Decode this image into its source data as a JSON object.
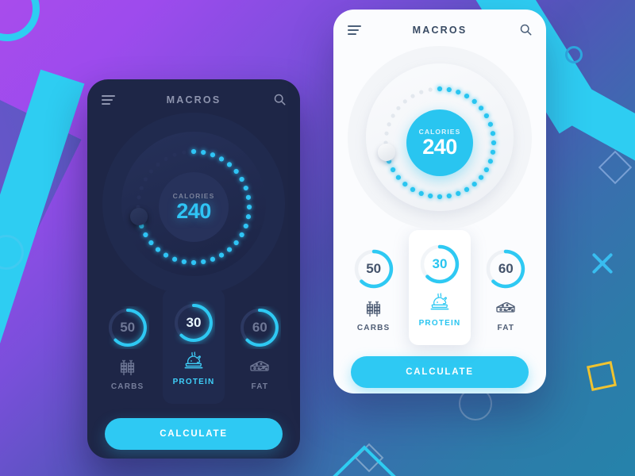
{
  "meta": {
    "accent_cyan": "#29c5f0",
    "dark_bg": "#1e2647",
    "light_bg": "#fbfcfe",
    "gold": "#f0c330"
  },
  "phone_dark": {
    "header": {
      "menu_icon": "hamburger-menu-icon",
      "title": "MACROS",
      "search_icon": "search-icon"
    },
    "dial": {
      "label": "CALORIES",
      "value": "240",
      "progress_pct": 72,
      "total_dots": 36
    },
    "macros": [
      {
        "value": "50",
        "name": "CARBS",
        "icon": "wheat-icon",
        "progress_pct": 72,
        "selected": false
      },
      {
        "value": "30",
        "name": "PROTEIN",
        "icon": "roast-chicken-icon",
        "progress_pct": 72,
        "selected": true
      },
      {
        "value": "60",
        "name": "FAT",
        "icon": "cheese-wedge-icon",
        "progress_pct": 72,
        "selected": false
      }
    ],
    "calculate_label": "CALCULATE"
  },
  "phone_light": {
    "header": {
      "menu_icon": "hamburger-menu-icon",
      "title": "MACROS",
      "search_icon": "search-icon"
    },
    "dial": {
      "label": "CALORIES",
      "value": "240",
      "progress_pct": 72,
      "total_dots": 36
    },
    "macros": [
      {
        "value": "50",
        "name": "CARBS",
        "icon": "wheat-icon",
        "progress_pct": 72,
        "selected": false
      },
      {
        "value": "30",
        "name": "PROTEIN",
        "icon": "roast-chicken-icon",
        "progress_pct": 72,
        "selected": true
      },
      {
        "value": "60",
        "name": "FAT",
        "icon": "cheese-wedge-icon",
        "progress_pct": 72,
        "selected": false
      }
    ],
    "calculate_label": "CALCULATE"
  },
  "background": {
    "shapes": [
      "cyan-ring-top-left",
      "cyan-diagonal-band-top-right",
      "small-circle-outline",
      "diamond-outline-right",
      "cyan-x-mark",
      "gold-square-outline",
      "cyan-diagonal-band-bottom-left",
      "cyan-triangle-outline-bottom",
      "circle-outline-bottom-center"
    ]
  }
}
